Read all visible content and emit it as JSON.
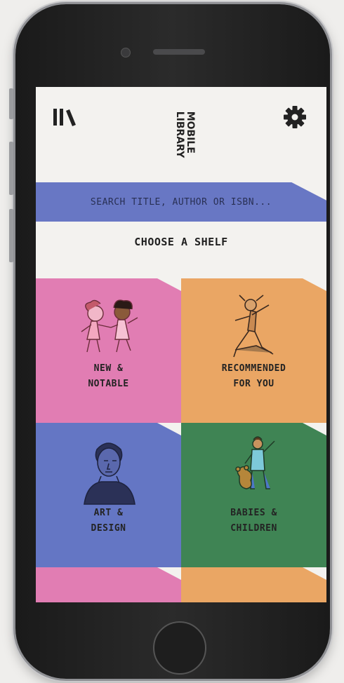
{
  "header": {
    "logo_line1": "MOBILE",
    "logo_line2": "LIBRARY"
  },
  "search": {
    "placeholder": "SEARCH TITLE, AUTHOR OR ISBN..."
  },
  "shelves_heading": "CHOOSE A SHELF",
  "shelves": [
    {
      "line1": "NEW &",
      "line2": "NOTABLE",
      "color": "#e17db3"
    },
    {
      "line1": "RECOMMENDED",
      "line2": "FOR YOU",
      "color": "#eaa664"
    },
    {
      "line1": "ART &",
      "line2": "DESIGN",
      "color": "#6476c4"
    },
    {
      "line1": "BABIES &",
      "line2": "CHILDREN",
      "color": "#3f8454"
    },
    {
      "line1": "",
      "line2": "",
      "color": "#e17db3"
    },
    {
      "line1": "",
      "line2": "",
      "color": "#eaa664"
    }
  ],
  "colors": {
    "search_band": "#6877c4",
    "background": "#f3f2ef"
  },
  "icons": {
    "menu": "library-books-icon",
    "settings": "gear-icon"
  }
}
